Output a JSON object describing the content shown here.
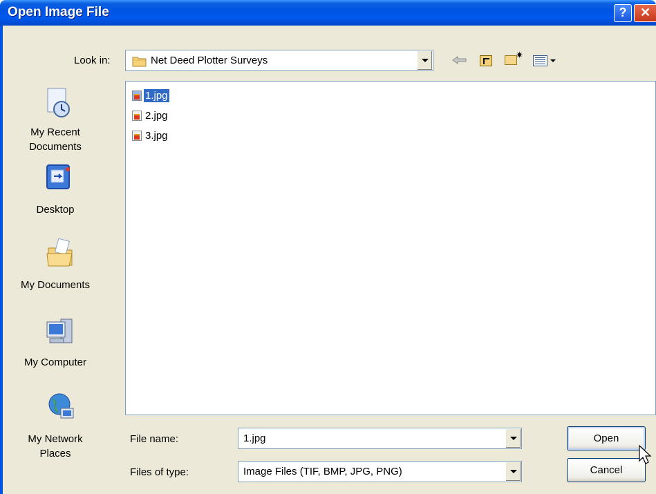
{
  "window": {
    "title": "Open Image File",
    "help_glyph": "?",
    "close_glyph": "✕"
  },
  "lookin": {
    "label": "Look in:",
    "value": "Net Deed Plotter Surveys",
    "icon": "folder-icon"
  },
  "toolbar": {
    "back_glyph": "⇐",
    "icons": [
      "back-icon",
      "up-one-level-icon",
      "new-folder-icon",
      "views-icon"
    ]
  },
  "places": [
    {
      "label": "My Recent Documents",
      "line1": "My Recent",
      "line2": "Documents",
      "icon": "recent-documents-icon"
    },
    {
      "label": "Desktop",
      "line1": "Desktop",
      "line2": "",
      "icon": "desktop-icon"
    },
    {
      "label": "My Documents",
      "line1": "My Documents",
      "line2": "",
      "icon": "my-documents-icon"
    },
    {
      "label": "My Computer",
      "line1": "My Computer",
      "line2": "",
      "icon": "my-computer-icon"
    },
    {
      "label": "My Network Places",
      "line1": "My Network",
      "line2": "Places",
      "icon": "network-places-icon"
    }
  ],
  "files": [
    {
      "name": "1.jpg",
      "selected": true
    },
    {
      "name": "2.jpg",
      "selected": false
    },
    {
      "name": "3.jpg",
      "selected": false
    }
  ],
  "filename": {
    "label": "File name:",
    "value": "1.jpg"
  },
  "filetype": {
    "label": "Files of type:",
    "value": "Image Files (TIF, BMP, JPG, PNG)"
  },
  "buttons": {
    "open": "Open",
    "cancel": "Cancel"
  },
  "colors": {
    "titlebar": "#0054e3",
    "selection": "#316ac5",
    "dialog_bg": "#ece9d8"
  }
}
